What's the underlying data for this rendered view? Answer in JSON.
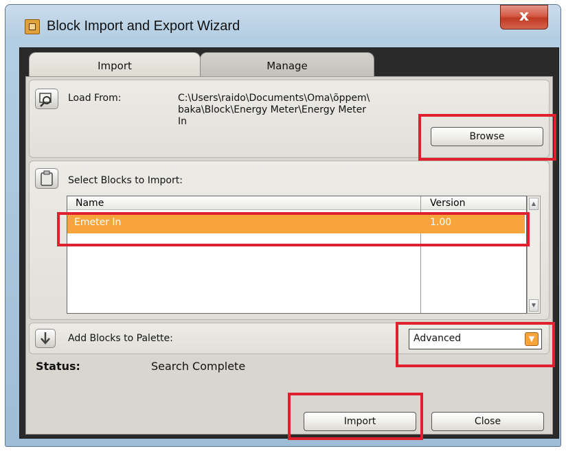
{
  "window": {
    "title": "Block Import and Export Wizard",
    "close_symbol": "x"
  },
  "tabs": [
    {
      "label": "Import",
      "selected": true
    },
    {
      "label": "Manage",
      "selected": false
    }
  ],
  "load_from": {
    "label": "Load From:",
    "path": "C:\\Users\\raido\\Documents\\Oma\\õppem\\\nbaka\\Block\\Energy Meter\\Energy Meter\nIn",
    "browse_label": "Browse",
    "icon": "folder-search-icon"
  },
  "select_blocks": {
    "label": "Select Blocks to Import:",
    "icon": "clipboard-icon",
    "columns": [
      "Name",
      "Version"
    ],
    "rows": [
      {
        "name": "Emeter In",
        "version": "1.00",
        "selected": true
      }
    ]
  },
  "add_to_palette": {
    "label": "Add Blocks to Palette:",
    "icon": "download-arrow-icon",
    "selected_value": "Advanced"
  },
  "status": {
    "label": "Status:",
    "value": "Search Complete"
  },
  "buttons": {
    "import_label": "Import",
    "close_label": "Close"
  },
  "colors": {
    "selection": "#f7a43a",
    "highlight": "#e0202e"
  }
}
